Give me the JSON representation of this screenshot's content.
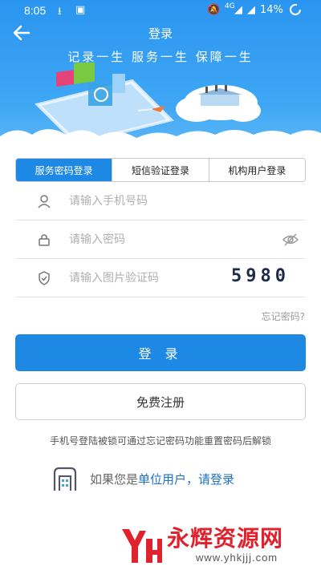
{
  "status_bar": {
    "time": "8:05",
    "battery": "14%"
  },
  "header": {
    "title": "登录",
    "slogan": "记录一生   服务一生   保障一生"
  },
  "tabs": [
    {
      "label": "服务密码登录",
      "active": true
    },
    {
      "label": "短信验证登录",
      "active": false
    },
    {
      "label": "机构用户登录",
      "active": false
    }
  ],
  "form": {
    "phone_placeholder": "请输入手机号码",
    "password_placeholder": "请输入密码",
    "captcha_placeholder": "请输入图片验证码",
    "captcha_code": "5980",
    "forgot_password": "忘记密码?"
  },
  "buttons": {
    "login": "登 录",
    "register": "免费注册"
  },
  "hint": "手机号登陆被锁可通过忘记密码功能重置密码后解锁",
  "org_login": {
    "prefix": "如果您是",
    "unit_user": "单位用户",
    "comma": "，",
    "link": "请登录"
  },
  "watermark": {
    "name": "永辉资源网",
    "url": "www.yhkjjj.com"
  },
  "colors": {
    "primary": "#1e88e5",
    "header_bg": "#2a95f0",
    "watermark": "#e0222e"
  }
}
